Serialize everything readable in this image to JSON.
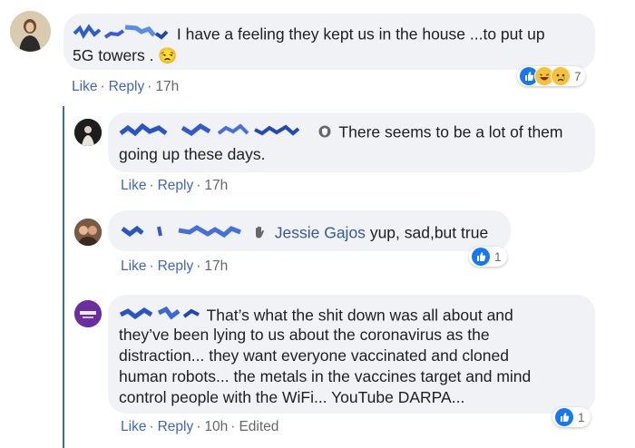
{
  "comments": [
    {
      "text": "I have a feeling they kept us in the house ...to put up",
      "text2": "5G towers .",
      "emoji": "😒",
      "actions": {
        "like": "Like",
        "reply": "Reply",
        "time": "17h"
      },
      "reaction_count": "7",
      "reaction_icons": [
        "like-icon",
        "haha-icon",
        "sad-icon"
      ]
    },
    {
      "text": "There seems to be a lot of them",
      "text2": "going up these days.",
      "badge_icon": "shield-badge-icon",
      "actions": {
        "like": "Like",
        "reply": "Reply",
        "time": "17h"
      }
    },
    {
      "mention": "Jessie Gajos",
      "text": "yup, sad,but true",
      "badge_icon": "wave-hand-icon",
      "actions": {
        "like": "Like",
        "reply": "Reply",
        "time": "17h"
      },
      "reaction_count": "1",
      "reaction_icons": [
        "like-icon"
      ]
    },
    {
      "lines": [
        "That’s what the shit down was all about and",
        "they’ve been lying to us about the coronavirus as the",
        "distraction... they want everyone vaccinated and cloned",
        "human robots... the metals in the vaccines target and mind",
        "control people with the WiFi... YouTube DARPA..."
      ],
      "actions": {
        "like": "Like",
        "reply": "Reply",
        "time": "10h",
        "edited": "Edited"
      },
      "reaction_count": "1",
      "reaction_icons": [
        "like-icon"
      ]
    }
  ],
  "colors": {
    "link": "#4267b2",
    "bubble": "#f0f2f5",
    "like": "#1877f2",
    "thread_line": "#4267b2"
  }
}
